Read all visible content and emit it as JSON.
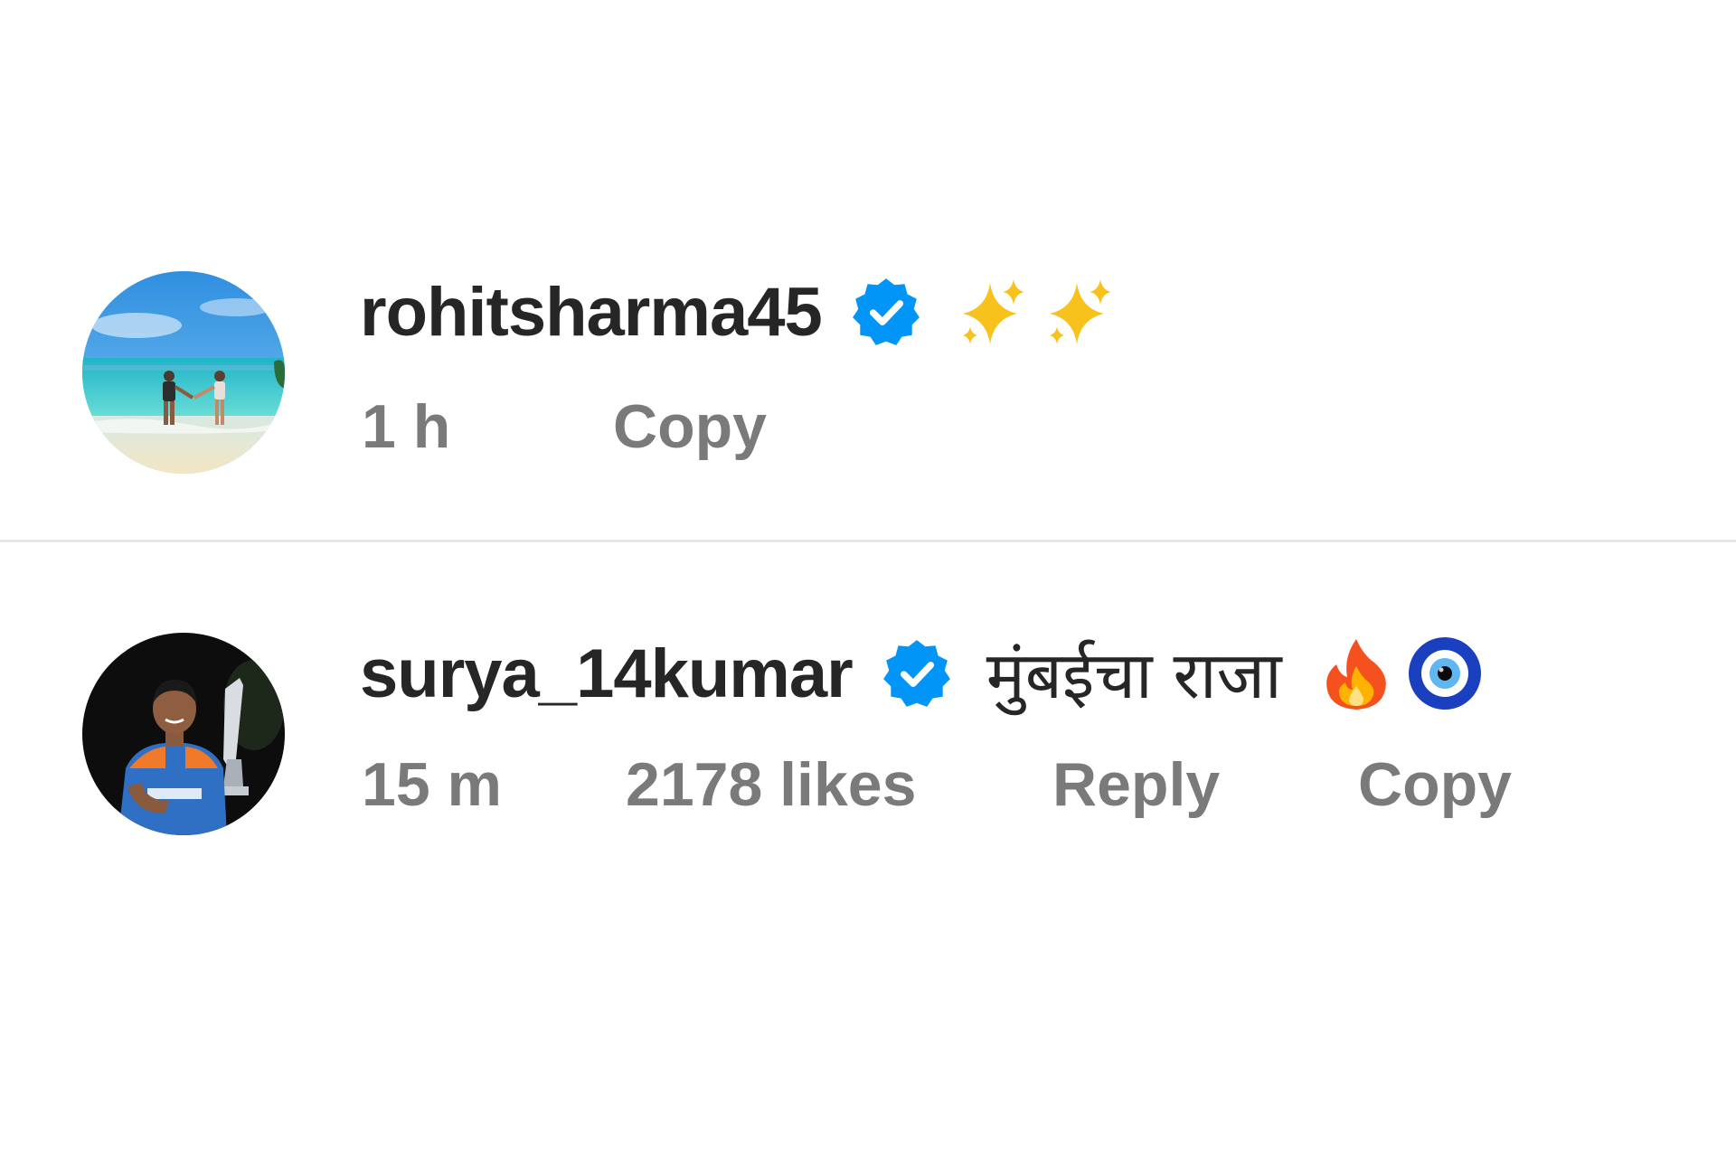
{
  "comments": [
    {
      "username": "rohitsharma45",
      "verified": true,
      "text": "",
      "emojis": [
        "sparkles",
        "sparkles"
      ],
      "time": "1 h",
      "actions": {
        "copy": "Copy"
      },
      "avatar": "beach-couple-photo"
    },
    {
      "username": "surya_14kumar",
      "verified": true,
      "text": "मुंबईचा राजा",
      "emojis": [
        "fire",
        "nazar-amulet"
      ],
      "time": "15 m",
      "likes": "2178 likes",
      "actions": {
        "reply": "Reply",
        "copy": "Copy"
      },
      "avatar": "cricketer-trophy-photo"
    }
  ],
  "colors": {
    "username": "#262626",
    "meta": "#7a7a7a",
    "verified_badge": "#0095f6",
    "divider": "#e6e6e6"
  }
}
